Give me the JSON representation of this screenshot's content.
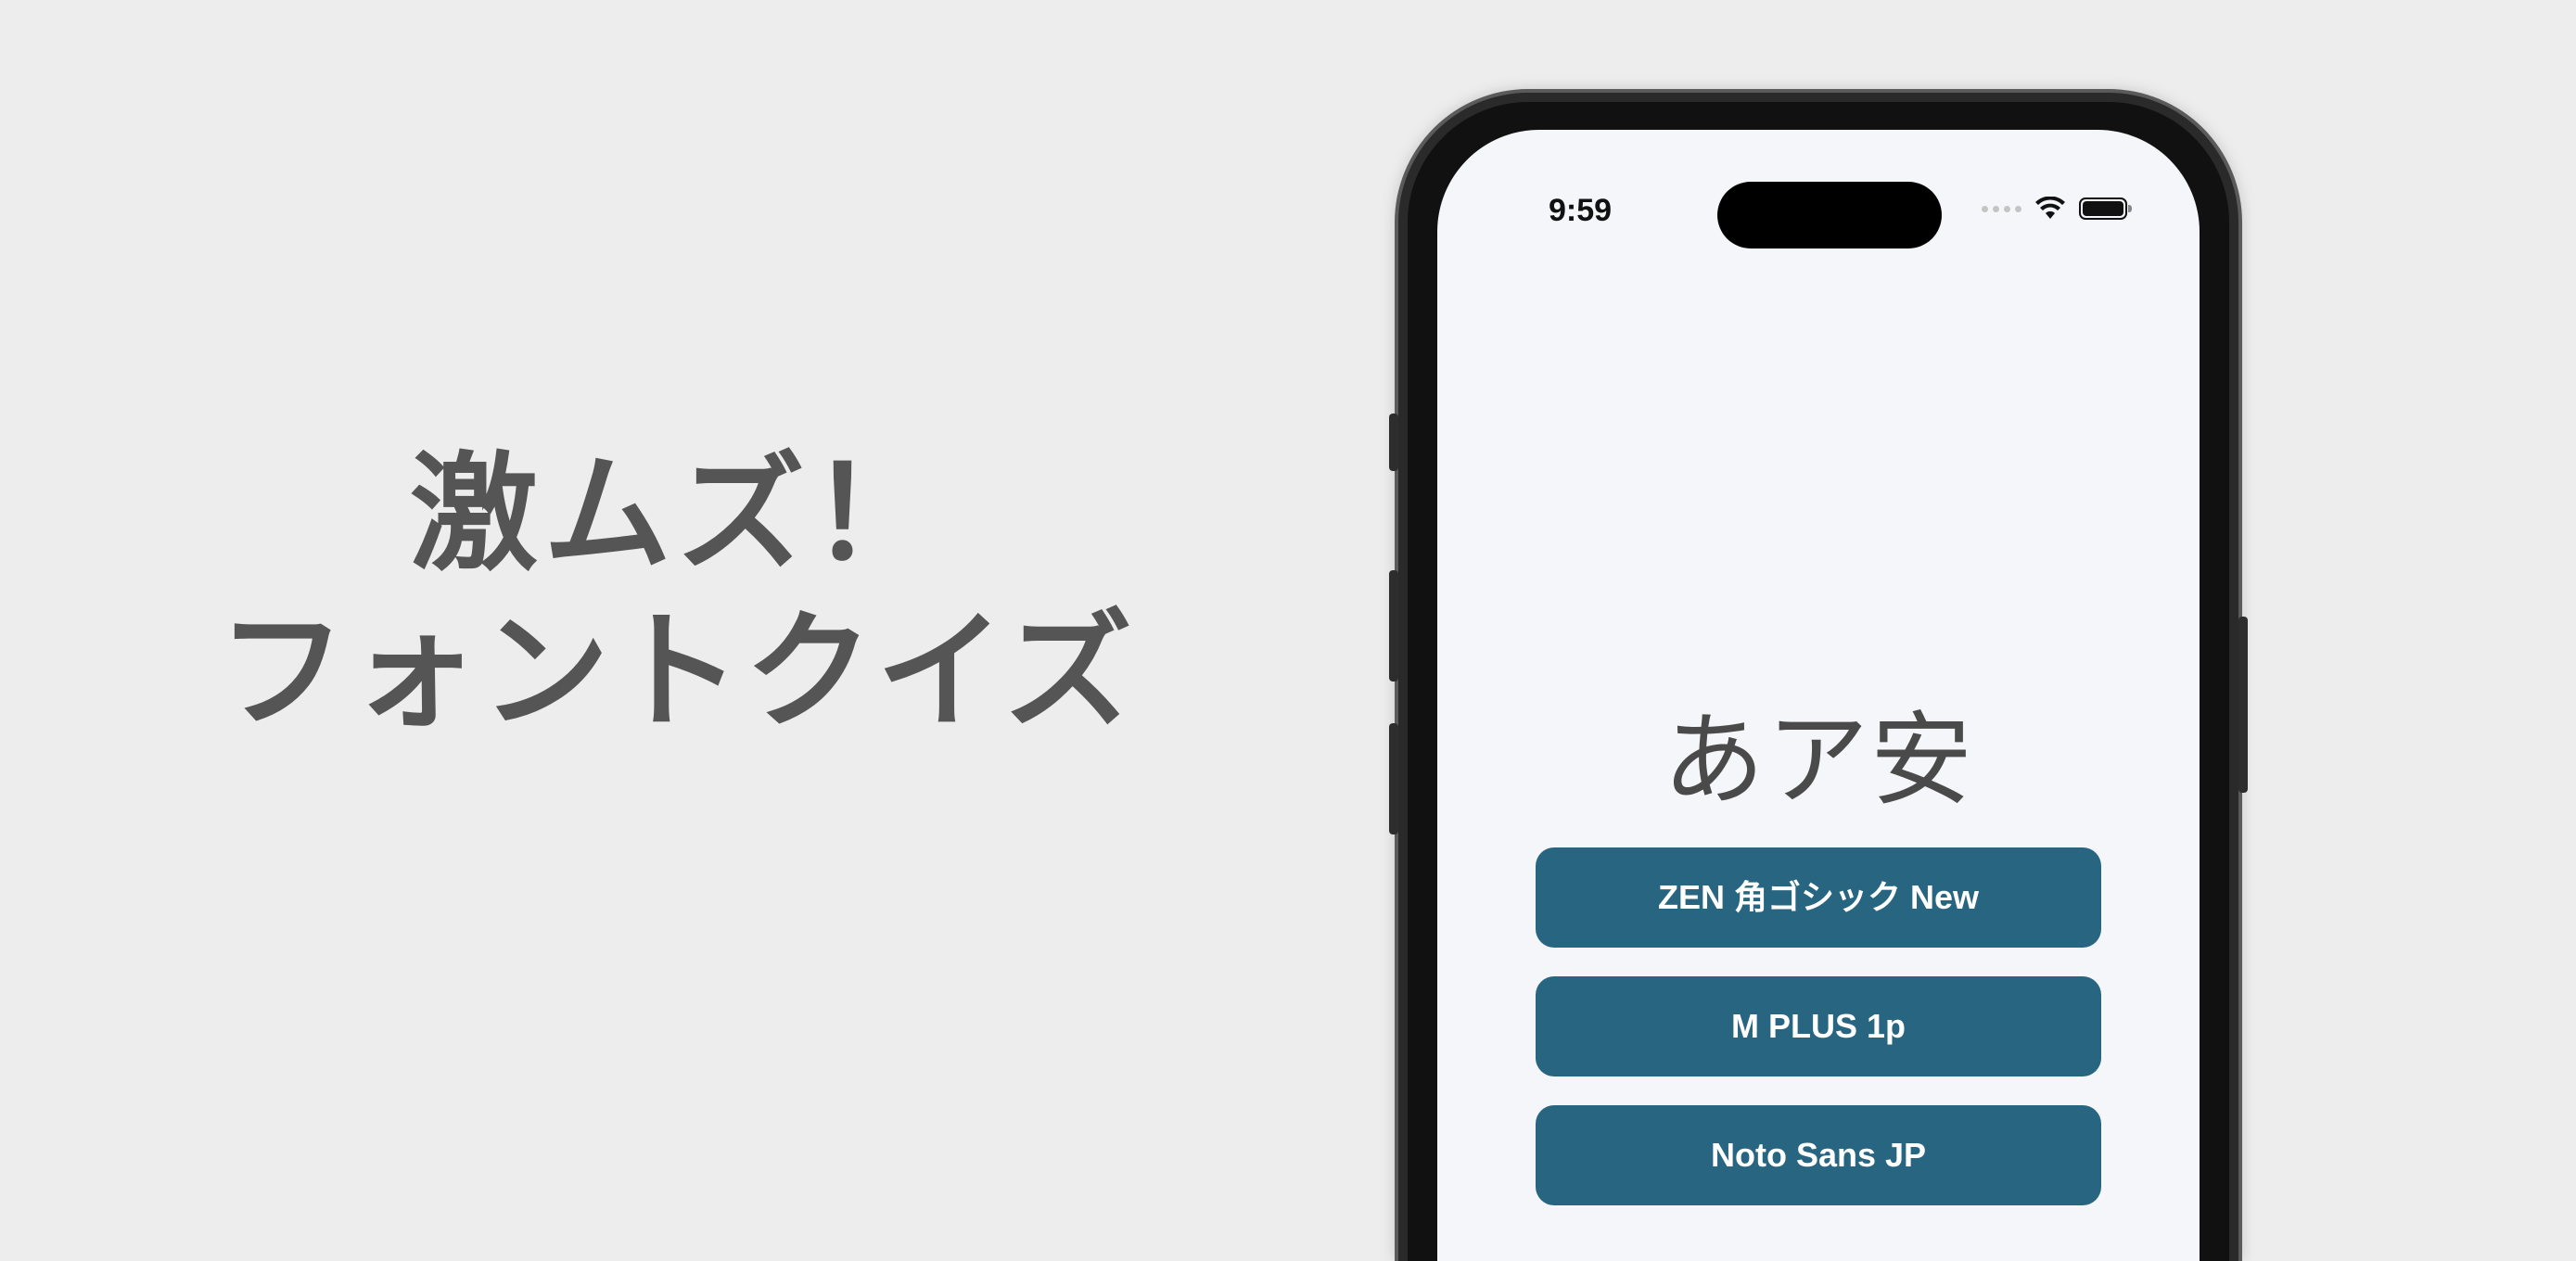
{
  "promo": {
    "line1": "激ムズ！",
    "line2": "フォントクイズ"
  },
  "status_bar": {
    "time": "9:59",
    "icons": [
      "signal-icon",
      "wifi-icon",
      "battery-icon"
    ]
  },
  "quiz": {
    "sample": "あア安",
    "options": [
      "ZEN 角ゴシック New",
      "M PLUS 1p",
      "Noto Sans JP"
    ]
  },
  "colors": {
    "background": "#ededed",
    "screen": "#f4f6fa",
    "button": "#276580",
    "button_text": "#ffffff",
    "headline": "#555555"
  }
}
